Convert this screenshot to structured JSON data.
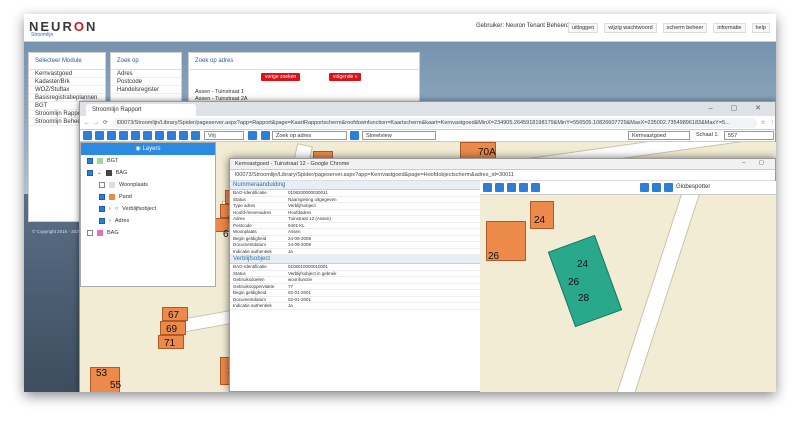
{
  "app": {
    "brand": "NEURON",
    "brand_sub": "Stroomlijn",
    "user": "Gebruiker: Neuron Tenant Beheerder",
    "links": [
      "uitloggen",
      "wijzig wachtwoord",
      "scherm beheer",
      "informatie",
      "help"
    ]
  },
  "module_panel": {
    "title": "Selecteer Module",
    "items": [
      "Kernvastgoed",
      "Kadaster/Brk",
      "WOZ/Stuftax",
      "Basisregistratieplannen",
      "BGT",
      "Stroomlijn Rapport",
      "Stroomlijn Beheer"
    ]
  },
  "zoek_panel": {
    "title": "Zoek op",
    "items": [
      "Adres",
      "Postcode",
      "Handelsregister"
    ]
  },
  "adres_panel": {
    "title": "Zoek op adres",
    "btn_prev": "vorige zoeken",
    "btn_next": "volgende »",
    "results": [
      "Assen - Tuinstraat 1",
      "Assen - Tuinstraat 2A"
    ]
  },
  "copyright": "© Copyright 2016 - 2020",
  "browser1": {
    "tab": "Stroomlijn Rapport",
    "url": "l00073/Stroomlijn/Library/Spider/pageserver.aspx?app=Rapport&page=KaartRapportscherm&roofdownfunction=Kaartscherm&kaart=Kernvastgoed&MinX=234905.2645918198179&MinY=556505.10826607729&MaxX=235002.73549896183&MaxY=5...",
    "search_select": "Zoek op adres",
    "view_select": "Streetview",
    "layer_select": "Kernvastgoed",
    "scale_label": "Schaal 1:",
    "scale_value": "557",
    "vrij": "Vrij"
  },
  "layers": {
    "title": "Layers",
    "items": [
      {
        "label": "BGT",
        "checked": true,
        "color": "#9fd89f"
      },
      {
        "label": "BAG",
        "checked": true,
        "color": "#444444"
      },
      {
        "label": "Woonplaats",
        "checked": false,
        "color": "#dddddd"
      },
      {
        "label": "Pand",
        "checked": true,
        "color": "#ec8a4c"
      },
      {
        "label": "Verblijfsobject",
        "checked": true,
        "color": ""
      },
      {
        "label": "Adres",
        "checked": true,
        "color": ""
      },
      {
        "label": "BAG",
        "checked": false,
        "color": "#e06fc6"
      }
    ]
  },
  "map_numbers": [
    "8",
    "6",
    "4",
    "2",
    "2B",
    "2A",
    "2",
    "1",
    "53",
    "55",
    "57",
    "59",
    "61",
    "22",
    "70A",
    "67",
    "69",
    "71",
    "28",
    "38",
    "40",
    "53",
    "55",
    "24",
    "26",
    "24",
    "26",
    "28"
  ],
  "browser2": {
    "title": "Kernvastgoed - Tuinstraat 12 - Google Chrome",
    "url": "l00073/Stroomlijn/Library/Spider/pageserver.aspx?app=Kernvastgoed&page=Hoofdobjectscherm&adres_id=30011",
    "globe": "Globespotter",
    "nummer_title": "Nummeraanduiding",
    "nummer_rows": [
      [
        "BAG-Identificatie",
        "0106200000030011"
      ],
      [
        "Status",
        "Naamgeving uitgegeven"
      ],
      [
        "Type adres",
        "Verblijfsobject"
      ],
      [
        "Hoofd-/nevenadres",
        "Hoofdadres"
      ],
      [
        "Adres",
        "Tuinstraat 12 (Assen)"
      ],
      [
        "Postcode",
        "9401 KL"
      ],
      [
        "Woonplaats",
        "Assen"
      ],
      [
        "Begin geldigheid",
        "24-09-2008"
      ],
      [
        "Documentdatum",
        "14-09-2008"
      ],
      [
        "Indicatie authentiek",
        "Ja"
      ]
    ],
    "verblijf_title": "Verblijfsobject",
    "verblijf_rows": [
      [
        "BAG-Identificatie",
        "0106010000010001"
      ],
      [
        "Status",
        "Verblijfsobject in gebruik"
      ],
      [
        "Gebruiksdoelen",
        "woonfunctie"
      ],
      [
        "Gebruiksoppervlakte",
        "77"
      ],
      [
        "Begin geldigheid",
        "02-01-2001"
      ],
      [
        "Documentdatum",
        "02-01-2001"
      ],
      [
        "Indicatie authentiek",
        "Ja"
      ]
    ]
  }
}
